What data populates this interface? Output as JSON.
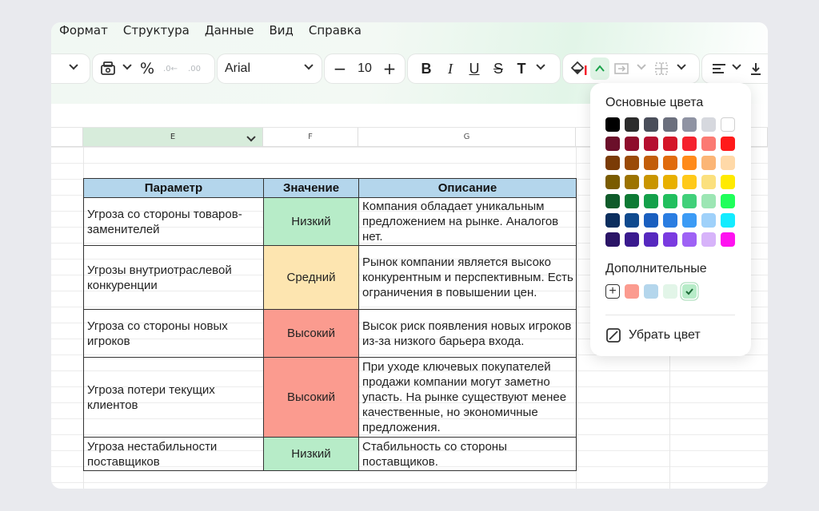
{
  "menu": [
    "Формат",
    "Структура",
    "Данные",
    "Вид",
    "Справка"
  ],
  "toolbar": {
    "font_name": "Arial",
    "font_size": "10",
    "percent": "%",
    "minus": "−",
    "plus": "+",
    "bold": "B",
    "italic": "I",
    "underline": "U",
    "strike": "S",
    "text_type": "T"
  },
  "columns": [
    "E",
    "F",
    "G"
  ],
  "table": {
    "headers": [
      "Параметр",
      "Значение",
      "Описание"
    ],
    "rows": [
      {
        "param": "Угроза со стороны товаров-заменителей",
        "value": "Низкий",
        "desc": "Компания обладает уникальным предложением на рынке. Аналогов нет.",
        "color": "#b7ecc8"
      },
      {
        "param": "Угрозы внутриотраслевой конкуренции",
        "value": "Средний",
        "desc": "Рынок компании является высоко конкурентным и перспективным. Есть ограничения в повышении цен.",
        "color": "#fde5b0"
      },
      {
        "param": "Угроза со стороны новых игроков",
        "value": "Высокий",
        "desc": "Высок риск появления новых игроков из-за низкого барьера входа.",
        "color": "#fb9b8f"
      },
      {
        "param": "Угроза потери текущих клиентов",
        "value": "Высокий",
        "desc": "При уходе ключевых покупателей продажи компании могут заметно упасть. На рынке существуют менее качественные, но экономичные предложения.",
        "color": "#fb9b8f"
      },
      {
        "param": "Угроза нестабильности поставщиков",
        "value": "Низкий",
        "desc": "Стабильность со стороны поставщиков.",
        "color": "#b7ecc8"
      }
    ]
  },
  "palette": {
    "title": "Основные цвета",
    "colors": [
      [
        "#000000",
        "#2b2b2b",
        "#4a4e5a",
        "#6b6f7d",
        "#8f93a3",
        "#d6d8de",
        "#ffffff"
      ],
      [
        "#6b0f2a",
        "#8e0d2c",
        "#b50f30",
        "#d41628",
        "#f5222d",
        "#fb7a72",
        "#ff1a1a"
      ],
      [
        "#7a3b06",
        "#9a4a07",
        "#c25d0a",
        "#e06b0d",
        "#ff8a1a",
        "#fbb576",
        "#ffd9a8"
      ],
      [
        "#7a5b00",
        "#9c7300",
        "#c99500",
        "#e8b000",
        "#ffc91a",
        "#fbe07e",
        "#ffea00"
      ],
      [
        "#0f5b2a",
        "#0d7a34",
        "#14a04a",
        "#22bf5e",
        "#41d07a",
        "#9ce6b4",
        "#1fff5a"
      ],
      [
        "#0b2e5e",
        "#0f4a8e",
        "#1a5fbf",
        "#2a7de1",
        "#3c9bf5",
        "#9fd1fa",
        "#13ecff"
      ],
      [
        "#2a1466",
        "#3a1a8e",
        "#5628bf",
        "#7a3be0",
        "#9e62f5",
        "#d7b3fa",
        "#ff12f0"
      ]
    ],
    "extra_title": "Дополнительные",
    "extra_colors": [
      "#fb9b8f",
      "#b4d6ec",
      "#e2f5e8",
      "#b7ecc8"
    ],
    "remove_label": "Убрать цвет"
  }
}
